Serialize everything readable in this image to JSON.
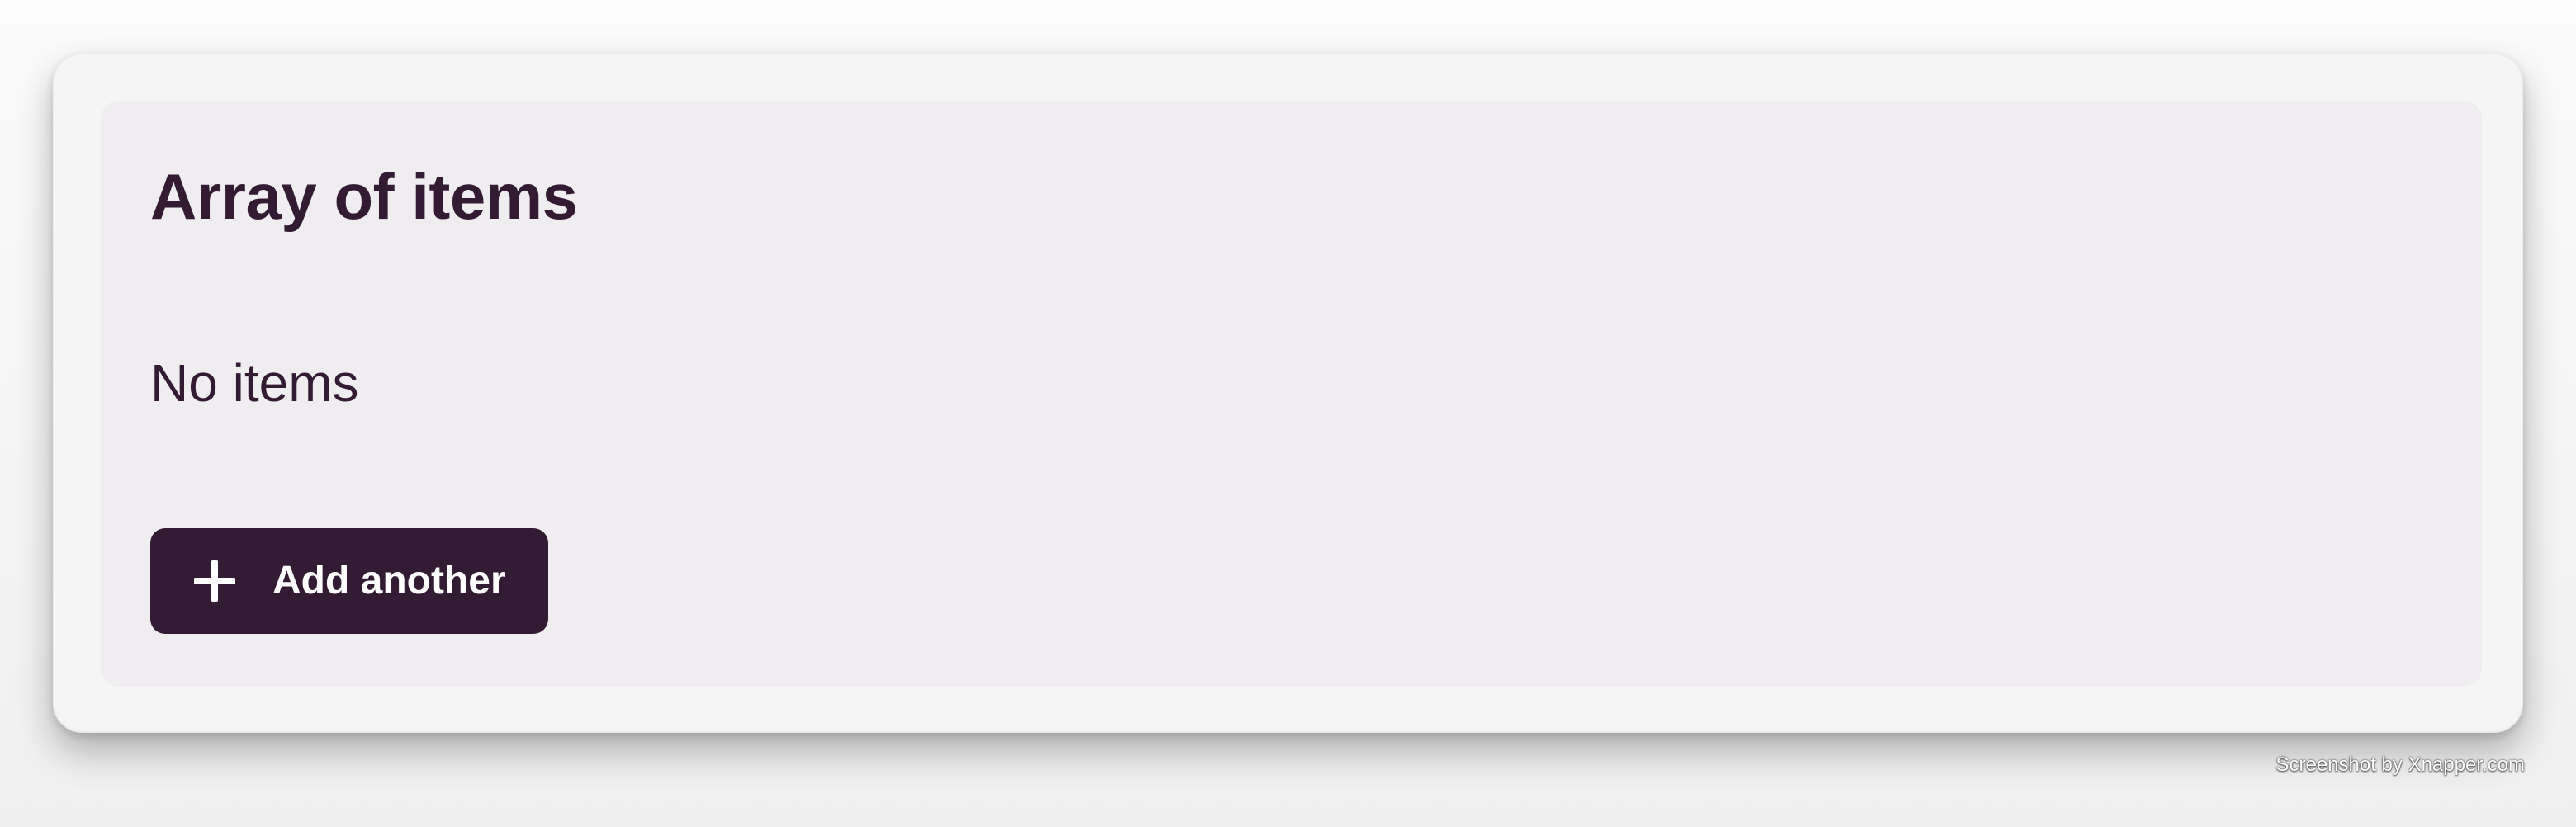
{
  "panel": {
    "title": "Array of items",
    "empty_text": "No items",
    "add_button_label": "Add another",
    "add_button_icon": "plus-icon"
  },
  "watermark": {
    "text": "Screenshot by Xnapper.com"
  },
  "colors": {
    "text": "#331b33",
    "button_background": "#331b33",
    "button_text": "#ffffff",
    "panel_background": "#efedf0",
    "window_background": "#f5f5f5"
  }
}
